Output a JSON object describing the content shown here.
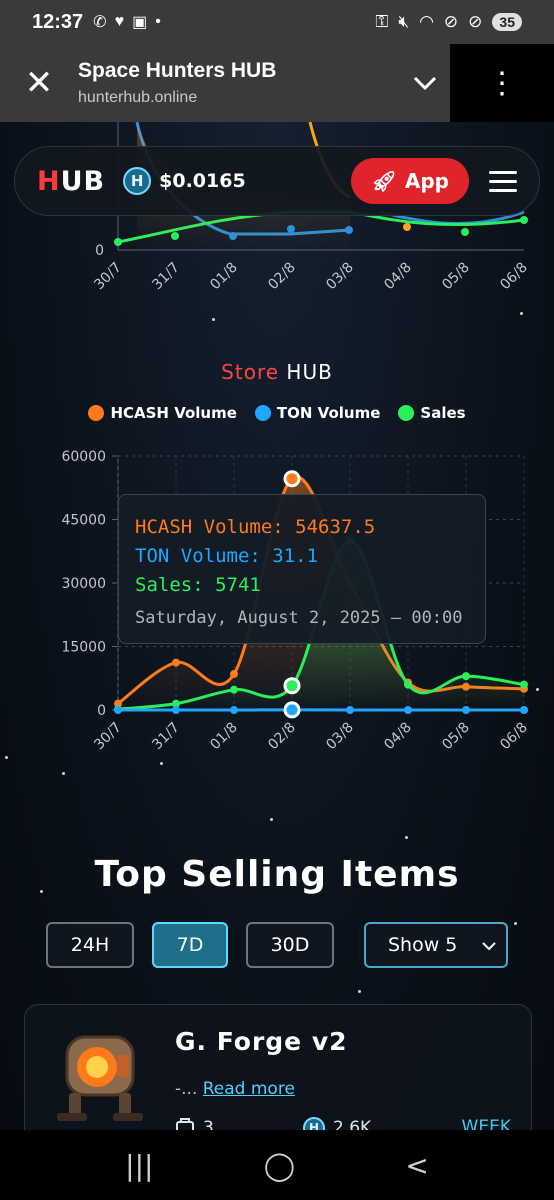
{
  "status": {
    "time": "12:37",
    "battery": "35"
  },
  "browser": {
    "title": "Space Hunters HUB",
    "url": "hunterhub.online"
  },
  "header": {
    "logo_h": "H",
    "logo_rest": "UB",
    "coin_symbol": "H",
    "price": "$0.0165",
    "app_button": "App"
  },
  "top_chart": {
    "y_label": "0",
    "x_labels": [
      "30/7",
      "31/7",
      "01/8",
      "02/8",
      "03/8",
      "04/8",
      "05/8",
      "06/8"
    ]
  },
  "store": {
    "title_red": "Store",
    "title_white": " HUB",
    "legend": [
      {
        "label": "HCASH Volume",
        "color": "#ff7a1a"
      },
      {
        "label": "TON Volume",
        "color": "#1fa6ff"
      },
      {
        "label": "Sales",
        "color": "#2bef5a"
      }
    ],
    "tooltip": {
      "line1": "HCASH Volume: 54637.5",
      "line2": "TON Volume: 31.1",
      "line3": "Sales: 5741",
      "date": "Saturday, August 2, 2025 – 00:00"
    }
  },
  "chart_data": {
    "type": "line",
    "title": "Store HUB",
    "x": [
      "30/7",
      "31/7",
      "01/8",
      "02/8",
      "03/8",
      "04/8",
      "05/8",
      "06/8"
    ],
    "ylim": [
      0,
      60000
    ],
    "yticks": [
      "0",
      "15000",
      "30000",
      "45000",
      "60000"
    ],
    "series": [
      {
        "name": "HCASH Volume",
        "color": "#ff7a1a",
        "values": [
          1500,
          11200,
          8500,
          54637.5,
          30000,
          6500,
          5500,
          5000
        ]
      },
      {
        "name": "TON Volume",
        "color": "#1fa6ff",
        "values": [
          0,
          0,
          0,
          31.1,
          0,
          0,
          0,
          0
        ]
      },
      {
        "name": "Sales",
        "color": "#2bef5a",
        "values": [
          200,
          1500,
          4800,
          5741,
          40000,
          6000,
          8000,
          6000
        ]
      }
    ],
    "legend": "top",
    "grid": true
  },
  "top_selling": {
    "title": "Top Selling Items",
    "filters": [
      "24H",
      "7D",
      "30D"
    ],
    "active_filter": "7D",
    "show_select": "Show 5",
    "item": {
      "name": "G. Forge v2",
      "desc_prefix": "-... ",
      "read_more": "Read more",
      "count": "3",
      "volume": "2.6K",
      "period": "WEEK"
    }
  }
}
